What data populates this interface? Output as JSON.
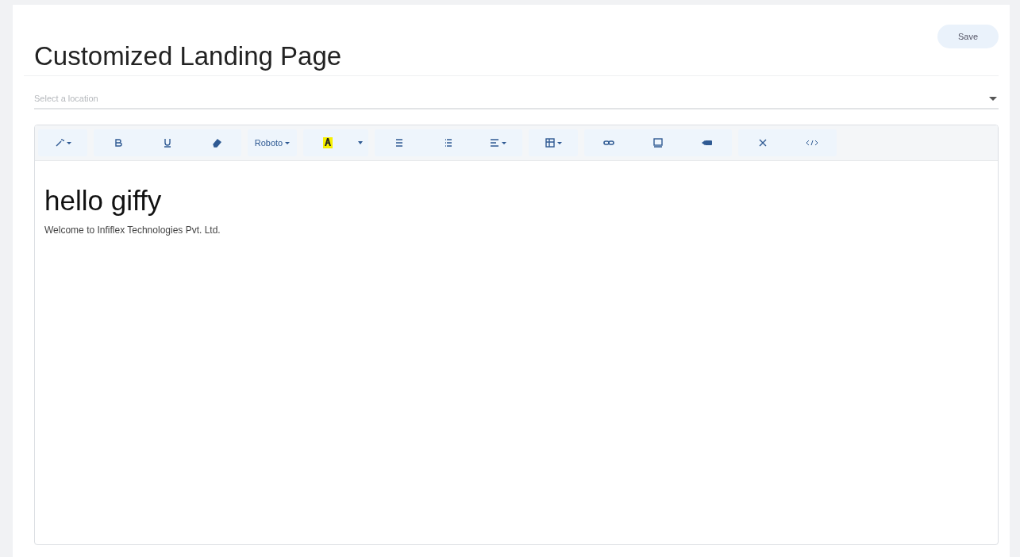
{
  "page": {
    "title": "Customized Landing Page",
    "save_button": "Save"
  },
  "location_select": {
    "placeholder": "Select a location"
  },
  "editor": {
    "toolbar": [
      {
        "buttons": [
          {
            "kind": "style",
            "dropdown": true
          }
        ]
      },
      {
        "buttons": [
          {
            "kind": "bold",
            "dropdown": false
          },
          {
            "kind": "underline",
            "dropdown": false
          },
          {
            "kind": "eraser",
            "dropdown": false
          }
        ]
      },
      {
        "buttons": [
          {
            "kind": "font",
            "label": "Roboto",
            "dropdown": true
          }
        ]
      },
      {
        "buttons": [
          {
            "kind": "color",
            "dropdown": false
          },
          {
            "kind": "caret",
            "dropdown": false
          }
        ]
      },
      {
        "buttons": [
          {
            "kind": "ul",
            "dropdown": false
          },
          {
            "kind": "ol",
            "dropdown": false
          },
          {
            "kind": "align",
            "dropdown": true
          }
        ]
      },
      {
        "buttons": [
          {
            "kind": "table",
            "dropdown": true
          }
        ]
      },
      {
        "buttons": [
          {
            "kind": "link",
            "dropdown": false
          },
          {
            "kind": "picture",
            "dropdown": false
          },
          {
            "kind": "video",
            "dropdown": false
          }
        ]
      },
      {
        "buttons": [
          {
            "kind": "fullscreen",
            "dropdown": false
          },
          {
            "kind": "code",
            "dropdown": false
          }
        ]
      }
    ],
    "content": [
      {
        "kind": "heading",
        "text": "hello giffy"
      },
      {
        "kind": "paragraph",
        "text": "Welcome to Infiflex Technologies Pvt. Ltd."
      }
    ]
  }
}
